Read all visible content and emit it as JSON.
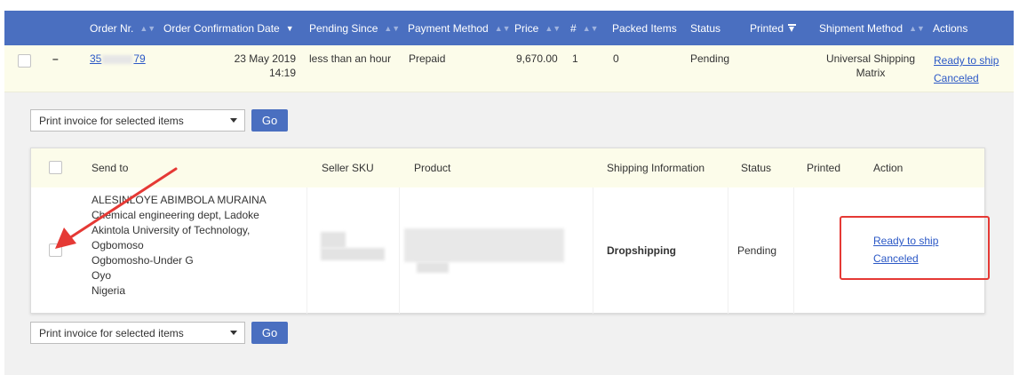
{
  "orders_table": {
    "columns": [
      {
        "label": "Order Nr.",
        "sortable": true
      },
      {
        "label": "Order Confirmation Date",
        "sortable": true,
        "active_sort": "descending"
      },
      {
        "label": "Pending Since",
        "sortable": true
      },
      {
        "label": "Payment Method",
        "sortable": true
      },
      {
        "label": "Price",
        "sortable": true
      },
      {
        "label": "#",
        "sortable": true
      },
      {
        "label": "Packed Items",
        "sortable": false
      },
      {
        "label": "Status",
        "sortable": false
      },
      {
        "label": "Printed",
        "filterable": true
      },
      {
        "label": "Shipment Method",
        "sortable": true
      },
      {
        "label": "Actions",
        "sortable": false
      }
    ],
    "row": {
      "expand_toggle": "–",
      "order_nr_prefix": "35",
      "order_nr_suffix": "79",
      "date_line1": "23 May 2019",
      "date_line2": "14:19",
      "pending_since": "less than an hour",
      "payment_method": "Prepaid",
      "price": "9,670.00",
      "count": "1",
      "packed_items": "0",
      "status": "Pending",
      "printed": "",
      "shipment_line1": "Universal Shipping",
      "shipment_line2": "Matrix",
      "actions": [
        "Ready to ship",
        "Canceled"
      ]
    }
  },
  "print_controls": {
    "select_value": "Print invoice for selected items",
    "go_label": "Go"
  },
  "items_panel": {
    "columns": [
      "Send to",
      "Seller SKU",
      "Product",
      "Shipping Information",
      "Status",
      "Printed",
      "Action"
    ],
    "row": {
      "address_lines": [
        "ALESINLOYE ABIMBOLA MURAINA",
        "Chemical engineering dept, Ladoke",
        "Akintola University of Technology,",
        "Ogbomoso",
        "Ogbomosho-Under G",
        "Oyo",
        "Nigeria"
      ],
      "shipping_information": "Dropshipping",
      "status": "Pending",
      "printed": "",
      "actions": [
        "Ready to ship",
        "Canceled"
      ]
    }
  },
  "colors": {
    "header_blue": "#4a6fc0",
    "row_highlight": "#fcfcea",
    "link": "#2b58c6",
    "annotation_red": "#e53935"
  }
}
